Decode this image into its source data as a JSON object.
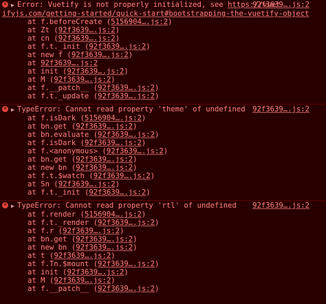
{
  "errors": [
    {
      "kind": "Error",
      "message": "Error: Vuetify is not properly initialized, see ",
      "message_link": "https://vuet",
      "source": "92f3639….js:2",
      "message_link_cont": "ifyjs.com/getting-started/quick-start#bootstrapping-the-vuetify-object",
      "frames": [
        {
          "fn": "f.beforeCreate",
          "loc": "5156904….js:2"
        },
        {
          "fn": "Zt",
          "loc": "92f3639….js:2"
        },
        {
          "fn": "cn",
          "loc": "92f3639….js:2"
        },
        {
          "fn": "f.t._init",
          "loc": "92f3639….js:2"
        },
        {
          "fn": "new f",
          "loc": "92f3639….js:2"
        },
        {
          "fn": "",
          "loc": "92f3639….js:2"
        },
        {
          "fn": "init",
          "loc": "92f3639….js:2"
        },
        {
          "fn": "M",
          "loc": "92f3639….js:2"
        },
        {
          "fn": "f.__patch__",
          "loc": "92f3639….js:2"
        },
        {
          "fn": "f.t._update",
          "loc": "92f3639….js:2"
        }
      ]
    },
    {
      "kind": "TypeError",
      "message": "TypeError: Cannot read property 'theme' of undefined",
      "source": "92f3639….js:2",
      "frames": [
        {
          "fn": "f.isDark",
          "loc": "5156904….js:2"
        },
        {
          "fn": "bn.get",
          "loc": "92f3639….js:2"
        },
        {
          "fn": "bn.evaluate",
          "loc": "92f3639….js:2"
        },
        {
          "fn": "f.isDark",
          "loc": "92f3639….js:2"
        },
        {
          "fn": "f.<anonymous>",
          "loc": "92f3639….js:2"
        },
        {
          "fn": "bn.get",
          "loc": "92f3639….js:2"
        },
        {
          "fn": "new bn",
          "loc": "92f3639….js:2"
        },
        {
          "fn": "f.t.$watch",
          "loc": "92f3639….js:2"
        },
        {
          "fn": "Sn",
          "loc": "92f3639….js:2"
        },
        {
          "fn": "f.t._init",
          "loc": "92f3639….js:2"
        }
      ]
    },
    {
      "kind": "TypeError",
      "message": "TypeError: Cannot read property 'rtl' of undefined",
      "source": "92f3639….js:2",
      "frames": [
        {
          "fn": "f.render",
          "loc": "5156904….js:2"
        },
        {
          "fn": "f.t._render",
          "loc": "92f3639….js:2"
        },
        {
          "fn": "f.r",
          "loc": "92f3639….js:2"
        },
        {
          "fn": "bn.get",
          "loc": "92f3639….js:2"
        },
        {
          "fn": "new bn",
          "loc": "92f3639….js:2"
        },
        {
          "fn": "t",
          "loc": "92f3639….js:2"
        },
        {
          "fn": "f.Tn.$mount",
          "loc": "92f3639….js:2"
        },
        {
          "fn": "init",
          "loc": "92f3639….js:2"
        },
        {
          "fn": "M",
          "loc": "92f3639….js:2"
        },
        {
          "fn": "f.__patch__",
          "loc": "92f3639….js:2"
        }
      ]
    }
  ],
  "labels": {
    "at": "at",
    "error_glyph": "✕",
    "expand_glyph": "▶"
  },
  "colors": {
    "background": "#290000",
    "text": "#fe8080",
    "separator": "#5b0000",
    "icon": "#e8453c"
  }
}
